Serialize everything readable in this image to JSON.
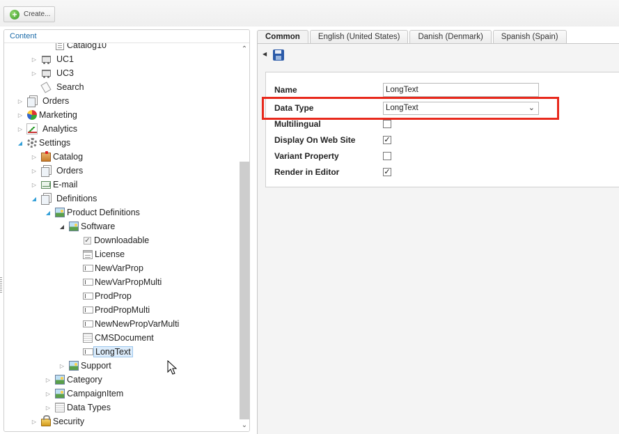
{
  "toolbar": {
    "create_label": "Create..."
  },
  "left_panel": {
    "header": "Content",
    "tree": [
      {
        "label": "Catalog10",
        "indent": 3,
        "icon": "catalog-icon",
        "exp": "none"
      },
      {
        "label": "UC1",
        "indent": 2,
        "icon": "cart-icon",
        "exp": "closed"
      },
      {
        "label": "UC3",
        "indent": 2,
        "icon": "cart-icon",
        "exp": "closed"
      },
      {
        "label": "Search",
        "indent": 2,
        "icon": "search-icon",
        "exp": "none"
      },
      {
        "label": "Orders",
        "indent": 1,
        "icon": "orders-icon",
        "exp": "closed"
      },
      {
        "label": "Marketing",
        "indent": 1,
        "icon": "pie-chart-icon",
        "exp": "closed"
      },
      {
        "label": "Analytics",
        "indent": 1,
        "icon": "line-chart-icon",
        "exp": "closed"
      },
      {
        "label": "Settings",
        "indent": 1,
        "icon": "gear-icon",
        "exp": "open"
      },
      {
        "label": "Catalog",
        "indent": 2,
        "icon": "box-icon",
        "exp": "closed"
      },
      {
        "label": "Orders",
        "indent": 2,
        "icon": "orders-icon",
        "exp": "closed"
      },
      {
        "label": "E-mail",
        "indent": 2,
        "icon": "email-icon",
        "exp": "closed"
      },
      {
        "label": "Definitions",
        "indent": 2,
        "icon": "orders-icon",
        "exp": "open"
      },
      {
        "label": "Product Definitions",
        "indent": 3,
        "icon": "image-icon",
        "exp": "open"
      },
      {
        "label": "Software",
        "indent": 4,
        "icon": "image-icon",
        "exp": "open-dark"
      },
      {
        "label": "Downloadable",
        "indent": 5,
        "icon": "checkbox-icon",
        "exp": "none"
      },
      {
        "label": "License",
        "indent": 5,
        "icon": "form-icon",
        "exp": "none"
      },
      {
        "label": "NewVarProp",
        "indent": 5,
        "icon": "text-field-icon",
        "exp": "none"
      },
      {
        "label": "NewVarPropMulti",
        "indent": 5,
        "icon": "text-field-icon",
        "exp": "none"
      },
      {
        "label": "ProdProp",
        "indent": 5,
        "icon": "text-field-icon",
        "exp": "none"
      },
      {
        "label": "ProdPropMulti",
        "indent": 5,
        "icon": "text-field-icon",
        "exp": "none"
      },
      {
        "label": "NewNewPropVarMulti",
        "indent": 5,
        "icon": "text-field-icon",
        "exp": "none"
      },
      {
        "label": "CMSDocument",
        "indent": 5,
        "icon": "grid-icon",
        "exp": "none"
      },
      {
        "label": "LongText",
        "indent": 5,
        "icon": "text-field-icon",
        "exp": "none",
        "selected": true
      },
      {
        "label": "Support",
        "indent": 4,
        "icon": "image-icon",
        "exp": "closed"
      },
      {
        "label": "Category",
        "indent": 3,
        "icon": "image-icon",
        "exp": "closed"
      },
      {
        "label": "CampaignItem",
        "indent": 3,
        "icon": "image-icon",
        "exp": "closed"
      },
      {
        "label": "Data Types",
        "indent": 3,
        "icon": "grid-icon",
        "exp": "closed"
      },
      {
        "label": "Security",
        "indent": 2,
        "icon": "lock-icon",
        "exp": "closed"
      }
    ]
  },
  "tabs": [
    {
      "label": "Common",
      "active": true
    },
    {
      "label": "English (United States)",
      "active": false
    },
    {
      "label": "Danish (Denmark)",
      "active": false
    },
    {
      "label": "Spanish (Spain)",
      "active": false
    }
  ],
  "form": {
    "name_label": "Name",
    "name_value": "LongText",
    "data_type_label": "Data Type",
    "data_type_value": "LongText",
    "multilingual_label": "Multilingual",
    "multilingual_checked": false,
    "display_label": "Display On Web Site",
    "display_checked": true,
    "variant_label": "Variant Property",
    "variant_checked": false,
    "render_label": "Render in Editor",
    "render_checked": true
  },
  "colors": {
    "highlight": "#e8291c",
    "selected_bg": "#dcecfb",
    "link_blue": "#1a6aa8"
  }
}
